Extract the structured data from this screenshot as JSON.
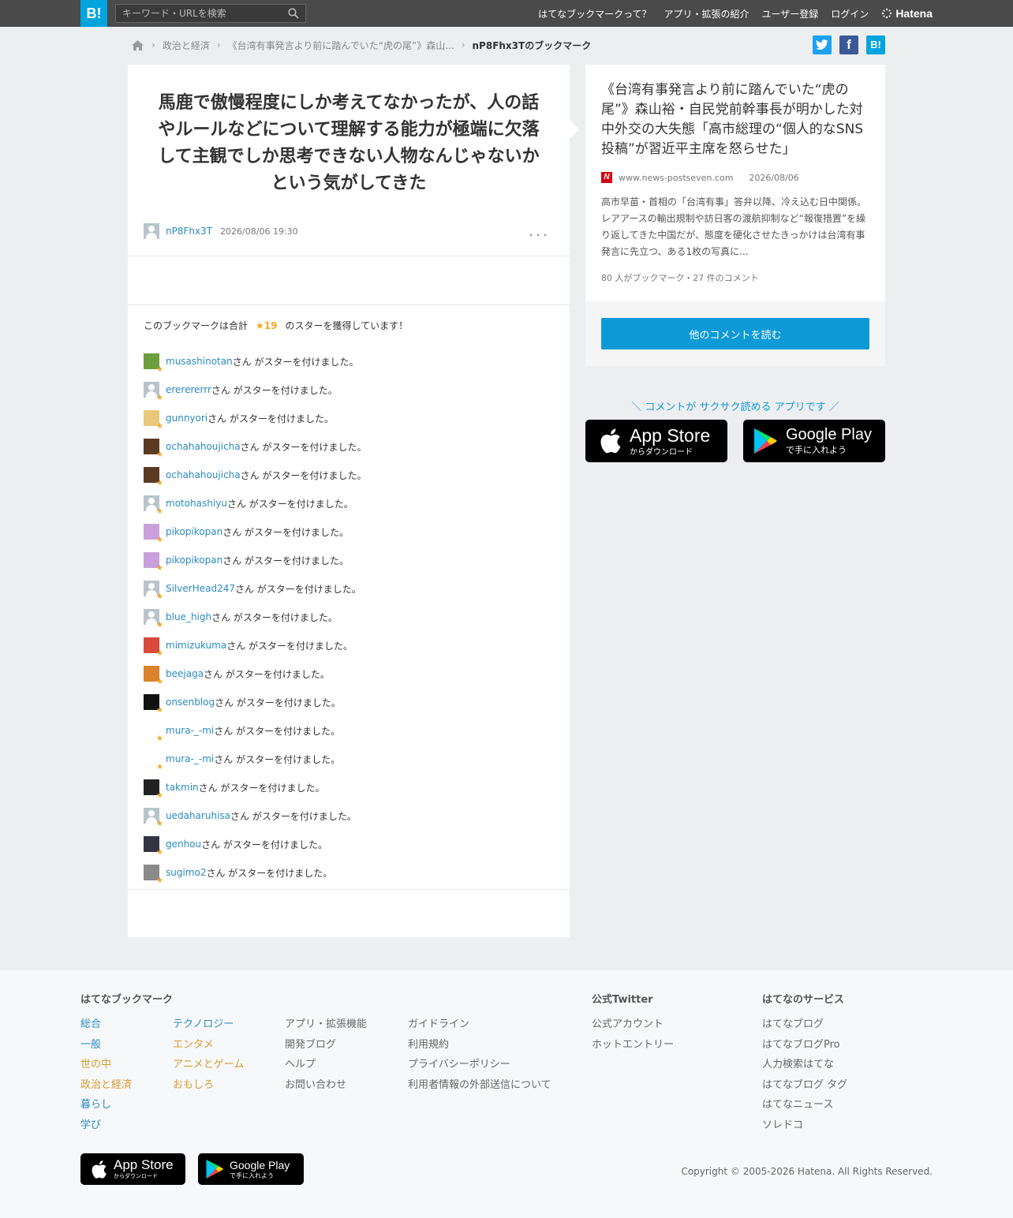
{
  "header": {
    "logo": "B!",
    "search_placeholder": "キーワード・URLを検索",
    "nav": [
      "はてなブックマークって？",
      "アプリ・拡張の紹介",
      "ユーザー登録",
      "ログイン"
    ],
    "brand": "Hatena"
  },
  "breadcrumb": {
    "items": [
      "政治と経済",
      "《台湾有事発言より前に踏んでいた“虎の尾”》森山...",
      "nP8Fhx3Tのブックマーク"
    ]
  },
  "share": {
    "twitter": "t",
    "facebook": "f",
    "hatena": "B!"
  },
  "bookmark": {
    "comment": "馬鹿で傲慢程度にしか考えてなかったが、人の話やルールなどについて理解する能力が極端に欠落して主観でしか思考できない人物なんじゃないかという気がしてきた",
    "user": "nP8Fhx3T",
    "datetime": "2026/08/06 19:30",
    "more": "･･･"
  },
  "stars": {
    "prefix": "このブックマークは合計",
    "count": "★19",
    "suffix": "のスターを獲得しています！",
    "suffix_text": "さん がスターを付けました。",
    "users": [
      "musashinotan",
      "ererererrr",
      "gunnyori",
      "ochahahoujicha",
      "ochahahoujicha",
      "motohashiyu",
      "pikopikopan",
      "pikopikopan",
      "SilverHead247",
      "blue_high",
      "mimizukuma",
      "beejaga",
      "onsenblog",
      "mura-_-mi",
      "mura-_-mi",
      "takmin",
      "uedaharuhisa",
      "genhou",
      "sugimo2"
    ]
  },
  "entry": {
    "title": "《台湾有事発言より前に踏んでいた“虎の尾”》森山裕・自民党前幹事長が明かした対中外交の大失態「高市総理の“個人的なSNS投稿”が習近平主席を怒らせた」",
    "site_icon": "N",
    "site": "www.news-postseven.com",
    "date": "2026/08/06",
    "summary": "高市早苗・首相の「台湾有事」答弁以降、冷え込む日中関係。レアアースの輸出規制や訪日客の渡航抑制など“報復措置”を繰り返してきた中国だが、態度を硬化させたきっかけは台湾有事発言に先立つ、ある1枚の写真に...",
    "counts": "80 人がブックマーク・27 件のコメント",
    "more_button": "他のコメントを読む"
  },
  "promo": {
    "text": "＼ コメントが サクサク読める アプリです ／",
    "appstore_big": "App Store",
    "appstore_small": "からダウンロード",
    "googleplay_big": "Google Play",
    "googleplay_small": "で手に入れよう"
  },
  "footer": {
    "col1_title": "はてなブックマーク",
    "cats_blue": [
      "総合",
      "一般",
      "世の中",
      "政治と経済",
      "暮らし",
      "学び"
    ],
    "cats_orange": [
      "テクノロジー",
      "エンタメ",
      "アニメとゲーム",
      "おもしろ"
    ],
    "links_a": [
      "アプリ・拡張機能",
      "開発ブログ",
      "ヘルプ",
      "お問い合わせ"
    ],
    "links_b": [
      "ガイドライン",
      "利用規約",
      "プライバシーポリシー",
      "利用者情報の外部送信について"
    ],
    "twitter_title": "公式Twitter",
    "twitter_links": [
      "公式アカウント",
      "ホットエントリー"
    ],
    "services_title": "はてなのサービス",
    "services": [
      "はてなブログ",
      "はてなブログPro",
      "人力検索はてな",
      "はてなブログ タグ",
      "はてなニュース",
      "ソレドコ"
    ],
    "copyright": "Copyright © 2005-2026 Hatena. All Rights Reserved."
  }
}
